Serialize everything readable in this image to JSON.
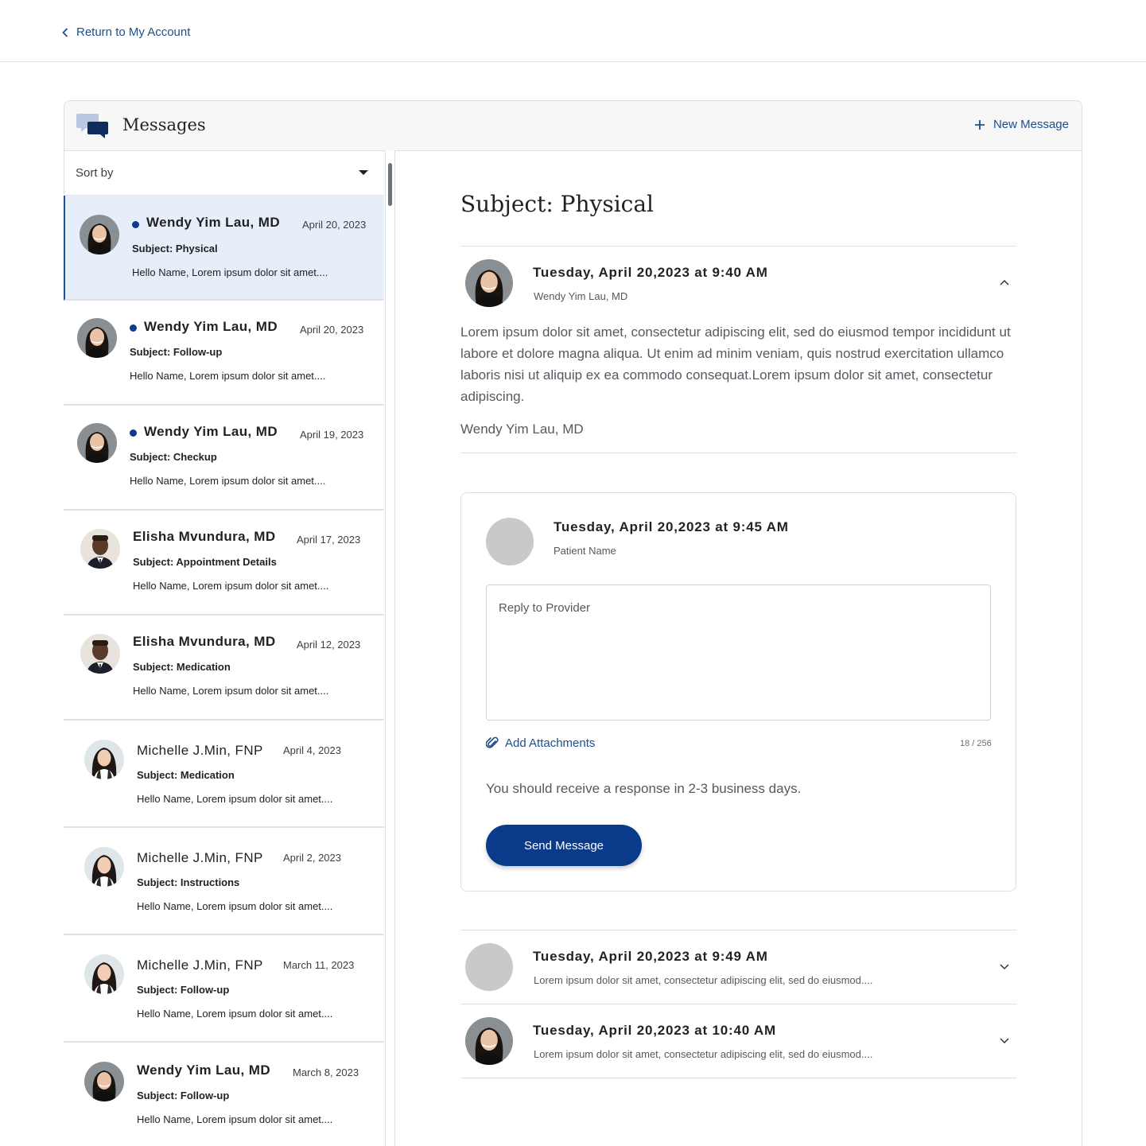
{
  "nav": {
    "back_label": "Return to My Account"
  },
  "header": {
    "title": "Messages",
    "new_message_label": "New Message"
  },
  "sort": {
    "label": "Sort by"
  },
  "messages": [
    {
      "name": "Wendy Yim Lau, MD",
      "date": "April 20, 2023",
      "subject": "Subject: Physical",
      "preview": "Hello Name, Lorem ipsum dolor sit amet....",
      "unread": true,
      "active": true,
      "avatar": "female-asian"
    },
    {
      "name": "Wendy Yim Lau, MD",
      "date": "April 20, 2023",
      "subject": "Subject: Follow-up",
      "preview": "Hello Name, Lorem ipsum dolor sit amet....",
      "unread": true,
      "active": false,
      "avatar": "female-asian"
    },
    {
      "name": "Wendy Yim Lau, MD",
      "date": "April 19, 2023",
      "subject": "Subject: Checkup",
      "preview": "Hello Name, Lorem ipsum dolor sit amet....",
      "unread": true,
      "active": false,
      "avatar": "female-asian"
    },
    {
      "name": "Elisha Mvundura, MD",
      "date": "April 17, 2023",
      "subject": "Subject: Appointment Details",
      "preview": "Hello Name, Lorem ipsum dolor sit amet....",
      "unread": false,
      "active": false,
      "avatar": "male"
    },
    {
      "name": "Elisha Mvundura, MD",
      "date": "April 12, 2023",
      "subject": "Subject: Medication",
      "preview": "Hello Name, Lorem ipsum dolor sit amet....",
      "unread": false,
      "active": false,
      "avatar": "male"
    },
    {
      "name": "Michelle J.Min, FNP",
      "date": "April 4, 2023",
      "subject": "Subject: Medication",
      "preview": "Hello Name, Lorem ipsum dolor sit amet....",
      "unread": false,
      "active": false,
      "avatar": "female-long"
    },
    {
      "name": "Michelle J.Min, FNP",
      "date": "April 2, 2023",
      "subject": "Subject: Instructions",
      "preview": "Hello Name, Lorem ipsum dolor sit amet....",
      "unread": false,
      "active": false,
      "avatar": "female-long"
    },
    {
      "name": "Michelle J.Min, FNP",
      "date": "March 11, 2023",
      "subject": "Subject: Follow-up",
      "preview": "Hello Name, Lorem ipsum dolor sit amet....",
      "unread": false,
      "active": false,
      "avatar": "female-long"
    },
    {
      "name": "Wendy Yim Lau, MD",
      "date": "March 8, 2023",
      "subject": "Subject: Follow-up",
      "preview": "Hello Name, Lorem ipsum dolor sit amet....",
      "unread": false,
      "active": false,
      "avatar": "female-asian"
    }
  ],
  "detail": {
    "subject_title": "Subject: Physical",
    "first_message": {
      "timestamp": "Tuesday, April 20,2023 at 9:40 AM",
      "sender": "Wendy Yim Lau, MD",
      "body": "Lorem ipsum dolor sit amet, consectetur adipiscing elit, sed do eiusmod tempor incididunt ut labore et dolore magna aliqua. Ut enim ad minim veniam, quis nostrud exercitation ullamco laboris nisi ut aliquip ex ea commodo consequat.Lorem ipsum dolor sit amet, consectetur adipiscing.",
      "signature": "Wendy Yim Lau, MD"
    },
    "reply": {
      "timestamp": "Tuesday, April 20,2023 at 9:45 AM",
      "sender": "Patient Name",
      "placeholder": "Reply to Provider",
      "attach_label": "Add Attachments",
      "counter": "18 / 256",
      "note": "You should receive a response in 2-3 business days.",
      "send_label": "Send Message"
    },
    "collapsed": [
      {
        "timestamp": "Tuesday, April 20,2023 at 9:49 AM",
        "preview": "Lorem ipsum dolor sit amet, consectetur adipiscing elit, sed do eiusmod...."
      },
      {
        "timestamp": "Tuesday, April 20,2023 at 10:40 AM",
        "preview": "Lorem ipsum dolor sit amet, consectetur adipiscing elit, sed do eiusmod...."
      }
    ]
  },
  "colors": {
    "accent": "#1c4f8c",
    "button": "#0a3a8a",
    "active_row": "#e6eefa",
    "unread_dot": "#0d3a8c"
  }
}
